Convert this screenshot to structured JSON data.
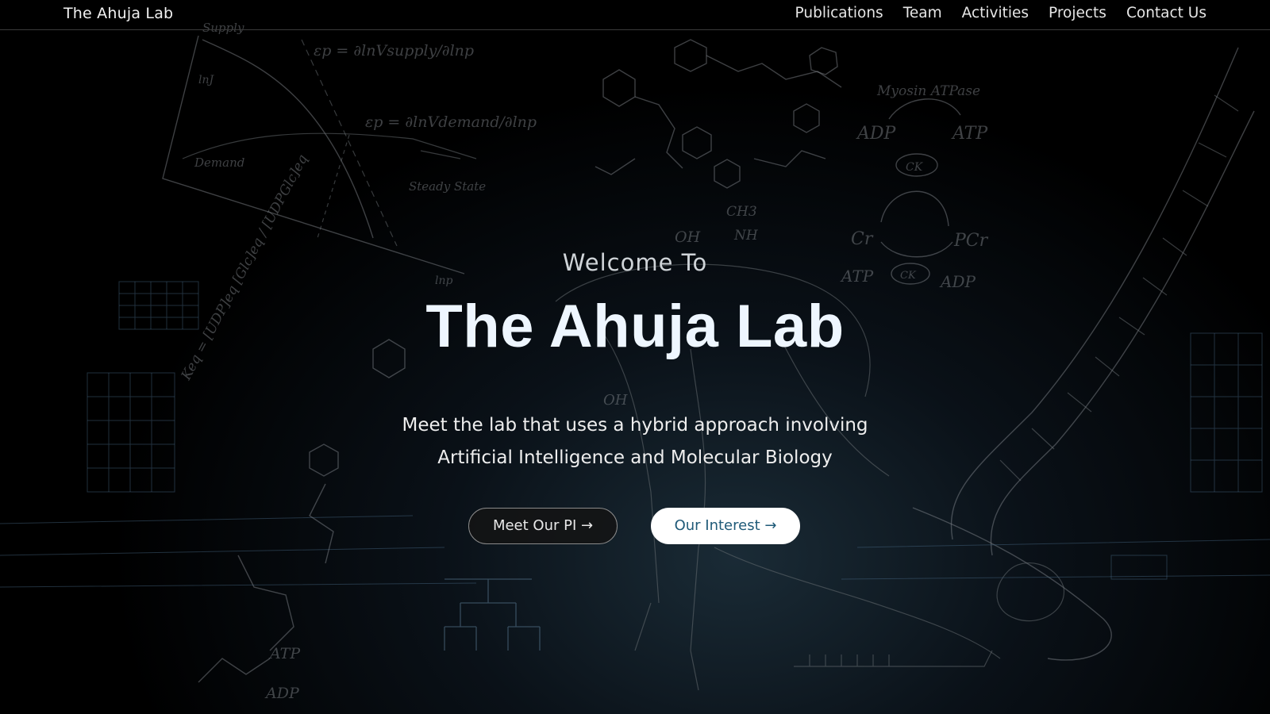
{
  "nav": {
    "brand": "The Ahuja Lab",
    "links": [
      "Publications",
      "Team",
      "Activities",
      "Projects",
      "Contact Us"
    ]
  },
  "hero": {
    "welcome": "Welcome To",
    "title": "The Ahuja Lab",
    "tagline_line1": "Meet the lab that uses a hybrid approach involving",
    "tagline_line2": "Artificial Intelligence and Molecular Biology",
    "btn_pi": "Meet Our PI →",
    "btn_interest": "Our Interest →"
  },
  "background": {
    "sketch_labels": {
      "supply": "Supply",
      "eps_p": "εp = ∂lnVsupply/∂lnp",
      "eps_d": "εp = ∂lnVdemand/∂lnp",
      "demand": "Demand",
      "steady_state": "Steady State",
      "ln_j": "lnJ",
      "ln_p": "lnp",
      "keq": "Keq = [UDP]eq [Glc]eq / [UDPGlc]eq",
      "myosin": "Myosin ATPase",
      "adp": "ADP",
      "atp": "ATP",
      "ck": "CK",
      "cr": "Cr",
      "pcr": "PCr",
      "oh": "OH",
      "ch3": "CH3",
      "nh": "NH"
    },
    "colors": {
      "sketch": "#8a8f94",
      "blueprint": "#4a6b87",
      "glow": "#1a2b36"
    }
  }
}
